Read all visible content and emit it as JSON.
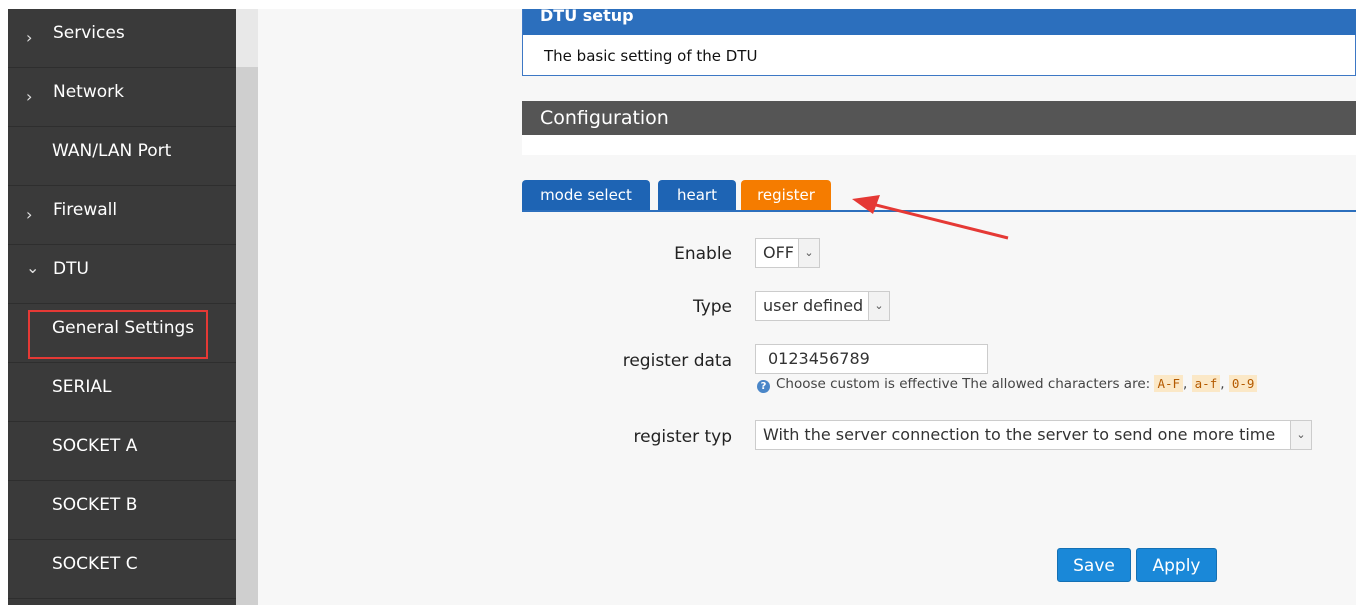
{
  "sidebar": {
    "items": [
      {
        "label": "Services",
        "expand": "collapsed"
      },
      {
        "label": "Network",
        "expand": "collapsed"
      },
      {
        "label": "WAN/LAN Port",
        "expand": "none"
      },
      {
        "label": "Firewall",
        "expand": "collapsed"
      },
      {
        "label": "DTU",
        "expand": "expanded"
      },
      {
        "label": "General Settings",
        "expand": "none",
        "selected": true
      },
      {
        "label": "SERIAL",
        "expand": "none"
      },
      {
        "label": "SOCKET A",
        "expand": "none"
      },
      {
        "label": "SOCKET B",
        "expand": "none"
      },
      {
        "label": "SOCKET C",
        "expand": "none"
      }
    ],
    "chevron_right": "›",
    "chevron_down": "⌄"
  },
  "dtu_setup": {
    "title": "DTU setup",
    "description": "The basic setting of the DTU"
  },
  "configuration": {
    "title": "Configuration"
  },
  "tabs": [
    {
      "label": "mode select",
      "active": false
    },
    {
      "label": "heart",
      "active": false
    },
    {
      "label": "register",
      "active": true
    }
  ],
  "form": {
    "enable": {
      "label": "Enable",
      "value": "OFF"
    },
    "type": {
      "label": "Type",
      "value": "user defined"
    },
    "register_data": {
      "label": "register data",
      "value": "0123456789",
      "hint_prefix": "Choose custom is effective The allowed characters are: ",
      "hint_codes": [
        "A-F",
        "a-f",
        "0-9"
      ],
      "hint_sep": ", "
    },
    "register_typ": {
      "label": "register typ",
      "value": "With the server connection to the server to send one more time"
    }
  },
  "buttons": {
    "save": "Save",
    "apply": "Apply"
  },
  "colors": {
    "sidebar_bg": "#3a3a3a",
    "tab_blue": "#1e64b4",
    "tab_active": "#f57c00",
    "button_blue": "#1a88d8",
    "annotation_red": "#e53935"
  }
}
